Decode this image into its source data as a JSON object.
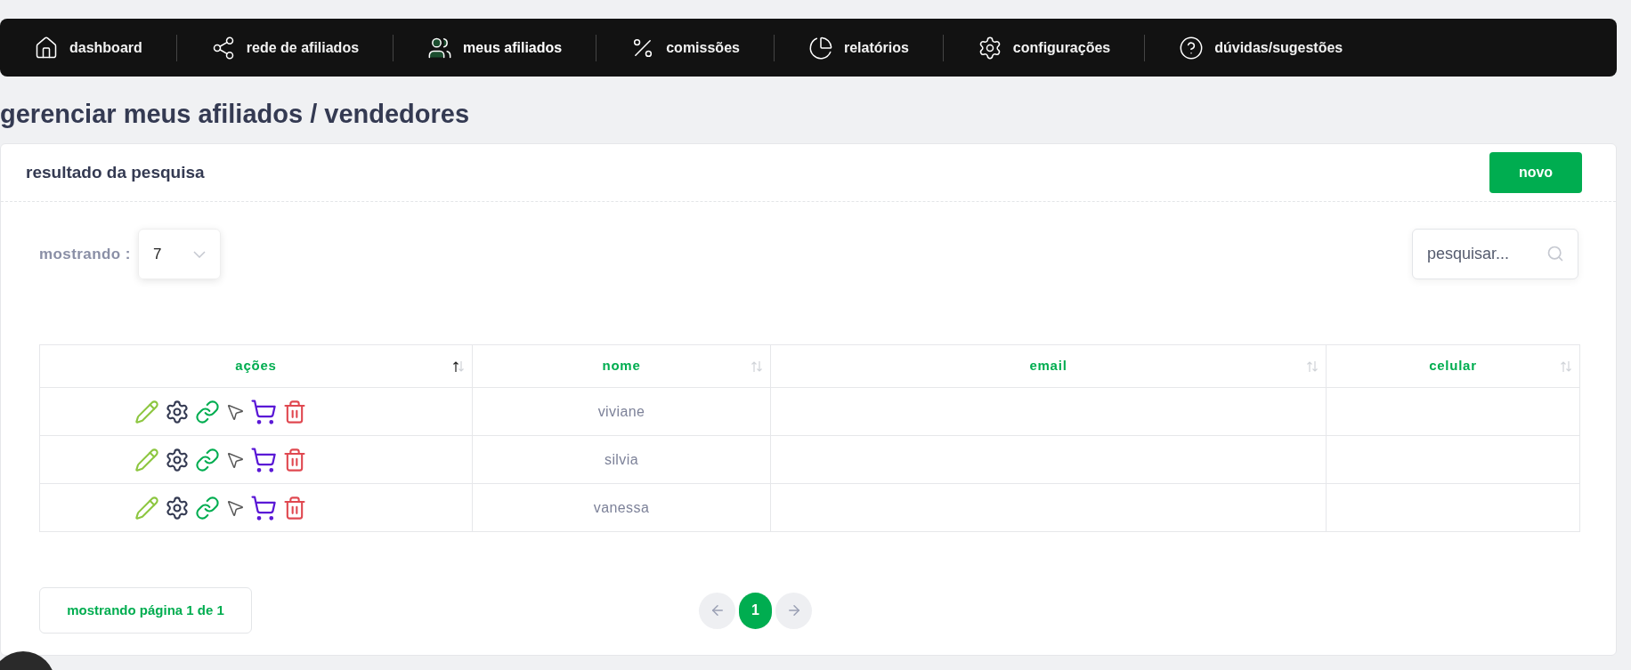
{
  "nav": {
    "items": [
      {
        "label": "dashboard",
        "selected": false
      },
      {
        "label": "rede de afiliados",
        "selected": false
      },
      {
        "label": "meus afiliados",
        "selected": true
      },
      {
        "label": "comissões",
        "selected": false
      },
      {
        "label": "relatórios",
        "selected": false
      },
      {
        "label": "configurações",
        "selected": false
      },
      {
        "label": "dúvidas/sugestões",
        "selected": false
      }
    ]
  },
  "page_title": "gerenciar meus afiliados / vendedores",
  "card": {
    "title": "resultado da pesquisa",
    "new_button": "novo",
    "page_size": {
      "label": "mostrando :",
      "value": "7"
    },
    "search": {
      "placeholder": "pesquisar..."
    },
    "table": {
      "columns": [
        {
          "label": "ações",
          "sorted_ascending": true
        },
        {
          "label": "nome",
          "sorted_ascending": false
        },
        {
          "label": "email",
          "sorted_ascending": false
        },
        {
          "label": "celular",
          "sorted_ascending": false
        }
      ],
      "rows": [
        {
          "nome": "viviane"
        },
        {
          "nome": "silvia"
        },
        {
          "nome": "vanessa"
        }
      ]
    },
    "page_info": "mostrando página 1 de 1",
    "pagination": {
      "pages": [
        {
          "label": "1",
          "selected": true
        }
      ]
    }
  }
}
